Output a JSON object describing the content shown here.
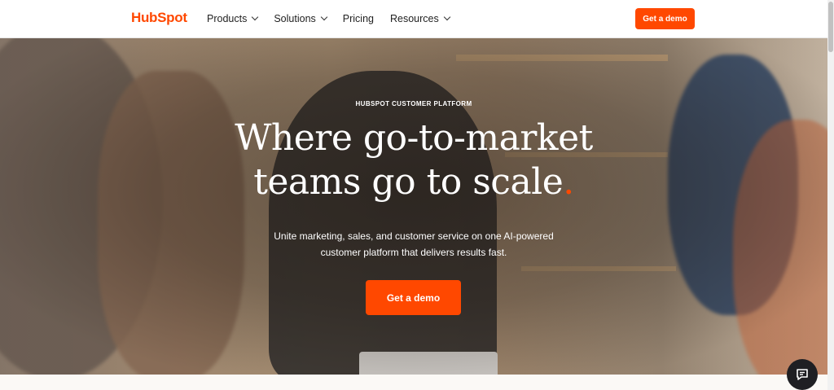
{
  "nav": {
    "logo": "HubSpot",
    "links": [
      {
        "label": "Products",
        "has_dropdown": true
      },
      {
        "label": "Solutions",
        "has_dropdown": true
      },
      {
        "label": "Pricing",
        "has_dropdown": false
      },
      {
        "label": "Resources",
        "has_dropdown": true
      }
    ],
    "cta_label": "Get a demo"
  },
  "hero": {
    "eyebrow": "HUBSPOT CUSTOMER PLATFORM",
    "headline_line1": "Where go-to-market",
    "headline_line2": "teams go to scale",
    "headline_period": ".",
    "subhead_line1": "Unite marketing, sales, and customer service on one AI-powered",
    "subhead_line2": "customer platform that delivers results fast.",
    "cta_label": "Get a demo"
  },
  "colors": {
    "brand": "#ff4800",
    "chat_button": "#1f1f23"
  },
  "icons": {
    "chat": "chat-bubble-icon",
    "dropdown": "chevron-down-icon"
  }
}
